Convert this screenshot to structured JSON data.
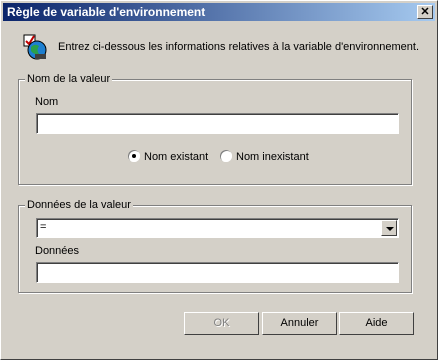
{
  "window": {
    "title": "Règle de variable d'environnement",
    "close": "✕"
  },
  "intro": "Entrez ci-dessous les informations relatives à la variable d'environnement.",
  "name_group": {
    "legend": "Nom de la valeur",
    "field_label": "Nom",
    "field_value": "",
    "radio_existing": "Nom existant",
    "radio_nonexisting": "Nom inexistant",
    "selected": "existing"
  },
  "data_group": {
    "legend": "Données de la valeur",
    "operator": "=",
    "field_label": "Données",
    "field_value": ""
  },
  "buttons": {
    "ok": "OK",
    "cancel": "Annuler",
    "help": "Aide"
  }
}
